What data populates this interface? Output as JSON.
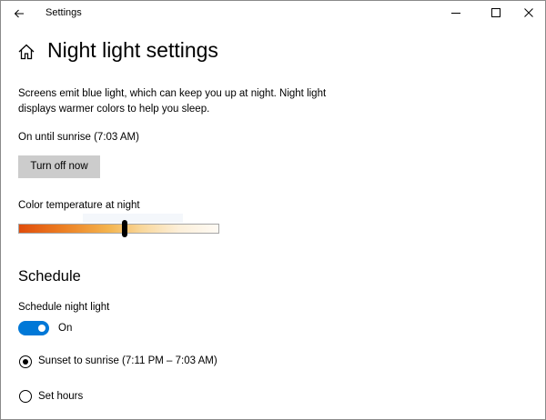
{
  "window": {
    "title": "Settings"
  },
  "header": {
    "title": "Night light settings"
  },
  "description": "Screens emit blue light, which can keep you up at night. Night light displays warmer colors to help you sleep.",
  "status": {
    "text": "On until sunrise (7:03 AM)",
    "turn_off_label": "Turn off now"
  },
  "color_temperature": {
    "label": "Color temperature at night",
    "level": 0.53
  },
  "schedule": {
    "heading": "Schedule",
    "toggle_label": "Schedule night light",
    "toggle_state": "On",
    "toggle_on": true,
    "options": [
      {
        "label": "Sunset to sunrise (7:11 PM – 7:03 AM)",
        "selected": true
      },
      {
        "label": "Set hours",
        "selected": false
      }
    ]
  },
  "colors": {
    "accent": "#0078d7",
    "button_bg": "#cccccc"
  },
  "icons": {
    "back": "back-arrow-icon",
    "home": "home-icon",
    "minimize": "minimize-icon",
    "maximize": "maximize-icon",
    "close": "close-icon"
  }
}
